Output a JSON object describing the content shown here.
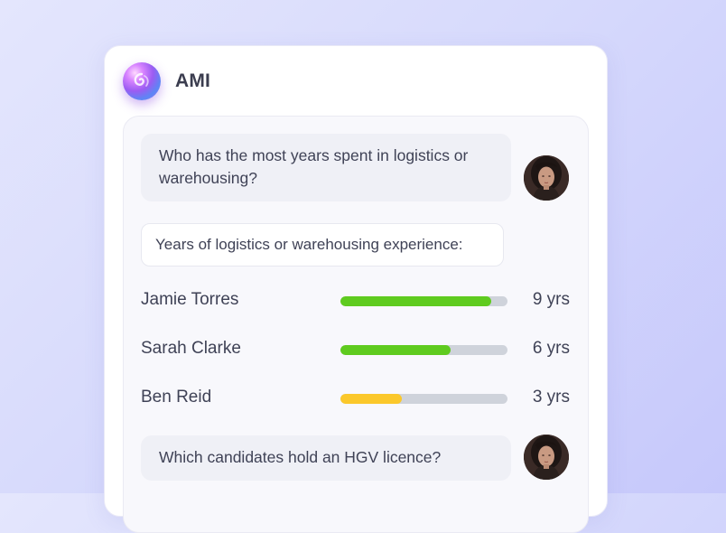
{
  "app": {
    "title": "AMI",
    "logo_icon": "ami-swirl-icon"
  },
  "conversation": {
    "question_1": "Who has the most years spent in logistics or warehousing?",
    "reply_heading": "Years of logistics or warehousing experience:",
    "candidates": [
      {
        "name": "Jamie Torres",
        "years": 9,
        "label": "9 yrs",
        "fraction": 0.9,
        "color": "#5fcb1f"
      },
      {
        "name": "Sarah Clarke",
        "years": 6,
        "label": "6 yrs",
        "fraction": 0.66,
        "color": "#5fcb1f"
      },
      {
        "name": "Ben Reid",
        "years": 3,
        "label": "3 yrs",
        "fraction": 0.37,
        "color": "#fbc82b"
      }
    ],
    "question_2": "Which candidates hold an HGV licence?"
  },
  "colors": {
    "bar_track": "#cfd3db",
    "text": "#3f4256"
  }
}
